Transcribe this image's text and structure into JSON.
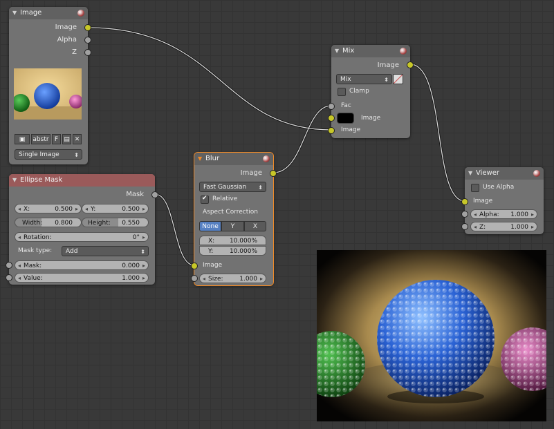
{
  "nodes": {
    "image": {
      "title": "Image",
      "outputs": [
        "Image",
        "Alpha",
        "Z"
      ],
      "buttons": {
        "name": "abstr",
        "fake": "F"
      },
      "source": "Single Image"
    },
    "ellipse_mask": {
      "title": "Ellipse Mask",
      "output": "Mask",
      "x_label": "X:",
      "x_value": "0.500",
      "y_label": "Y:",
      "y_value": "0.500",
      "width_label": "Width:",
      "width_value": "0.800",
      "height_label": "Height:",
      "height_value": "0.550",
      "rotation_label": "Rotation:",
      "rotation_value": "0°",
      "mask_type_label": "Mask type:",
      "mask_type_value": "Add",
      "mask_label": "Mask:",
      "mask_value": "0.000",
      "value_label": "Value:",
      "value_value": "1.000"
    },
    "blur": {
      "title": "Blur",
      "output": "Image",
      "filter": "Fast Gaussian",
      "relative_label": "Relative",
      "aspect_label": "Aspect Correction",
      "aspect_options": [
        "None",
        "Y",
        "X"
      ],
      "x_label": "X:",
      "x_value": "10.000%",
      "y_label": "Y:",
      "y_value": "10.000%",
      "image_input": "Image",
      "size_label": "Size:",
      "size_value": "1.000"
    },
    "mix": {
      "title": "Mix",
      "output": "Image",
      "blend": "Mix",
      "clamp_label": "Clamp",
      "fac_label": "Fac",
      "image1_label": "Image",
      "image2_label": "Image"
    },
    "viewer": {
      "title": "Viewer",
      "use_alpha_label": "Use Alpha",
      "image_input": "Image",
      "alpha_label": "Alpha:",
      "alpha_value": "1.000",
      "z_label": "Z:",
      "z_value": "1.000"
    }
  },
  "colors": {
    "socket_yellow": "#c7c729",
    "socket_grey": "#a1a1a1",
    "node_body": "#727272",
    "active_outline": "#f08a28",
    "selected_button": "#5680c2"
  }
}
